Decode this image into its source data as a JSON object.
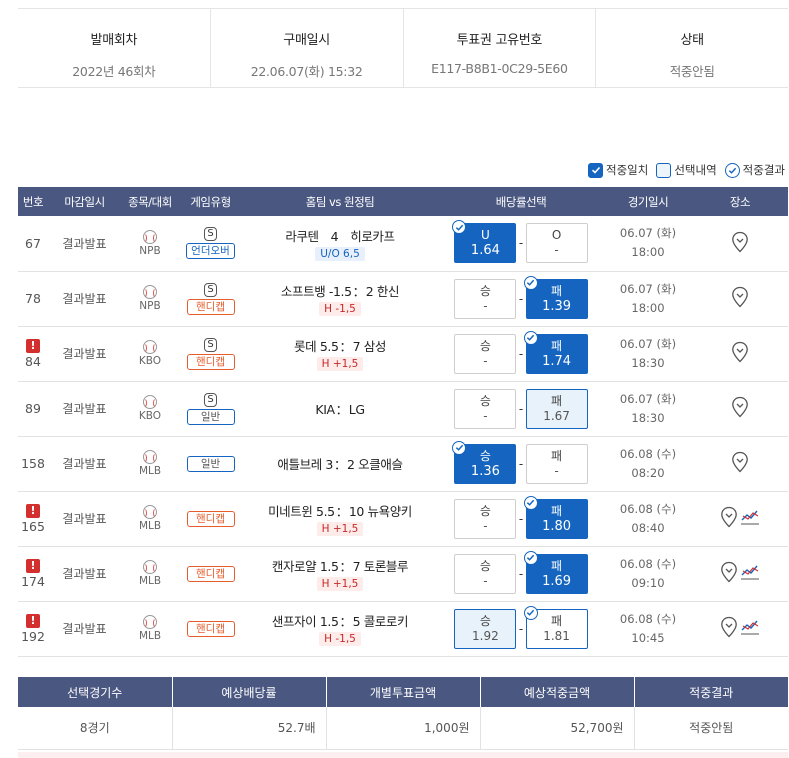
{
  "info": [
    {
      "label": "발매회차",
      "value": "2022년 46회차"
    },
    {
      "label": "구매일시",
      "value": "22.06.07(화) 15:32"
    },
    {
      "label": "투표권 고유번호",
      "value": "E117-B8B1-0C29-5E60"
    },
    {
      "label": "상태",
      "value": "적중안됨"
    }
  ],
  "legend": [
    {
      "label": "적중일치",
      "style": "checked"
    },
    {
      "label": "선택내역",
      "style": "empty"
    },
    {
      "label": "적중결과",
      "style": "circle-check"
    }
  ],
  "headers": [
    "번호",
    "마감일시",
    "종목/대회",
    "게임유형",
    "홈팀 vs 원정팀",
    "배당률선택",
    "경기일시",
    "장소"
  ],
  "rows": [
    {
      "no": "67",
      "warn": false,
      "deadline": "결과발표",
      "league": "NPB",
      "s_badge": "S",
      "type": "언더오버",
      "type_style": "blue",
      "home": "라쿠텐",
      "score": "4",
      "away": "히로카프",
      "sep": "",
      "handicap": "U/O 6,5",
      "handicap_style": "blue",
      "win_label": "U",
      "win_odds": "1.64",
      "win_state": "sel",
      "win_check": true,
      "draw": "-",
      "lose_label": "O",
      "lose_odds": "-",
      "lose_state": "plain",
      "lose_check": false,
      "date": "06.07 (화)",
      "time": "18:00",
      "extra_chart": false
    },
    {
      "no": "78",
      "warn": false,
      "deadline": "결과발표",
      "league": "NPB",
      "s_badge": "S",
      "type": "핸디캡",
      "type_style": "red",
      "home": "소프트뱅 -1.5",
      "score": "",
      "away": "2 한신",
      "sep": "：",
      "handicap": "H -1,5",
      "handicap_style": "red",
      "win_label": "승",
      "win_odds": "-",
      "win_state": "plain",
      "win_check": false,
      "draw": "-",
      "lose_label": "패",
      "lose_odds": "1.39",
      "lose_state": "sel",
      "lose_check": true,
      "date": "06.07 (화)",
      "time": "18:00",
      "extra_chart": false
    },
    {
      "no": "84",
      "warn": true,
      "deadline": "결과발표",
      "league": "KBO",
      "s_badge": "S",
      "type": "핸디캡",
      "type_style": "red",
      "home": "롯데 5.5",
      "score": "",
      "away": "7 삼성",
      "sep": "：",
      "handicap": "H +1,5",
      "handicap_style": "red",
      "win_label": "승",
      "win_odds": "-",
      "win_state": "plain",
      "win_check": false,
      "draw": "-",
      "lose_label": "패",
      "lose_odds": "1.74",
      "lose_state": "sel",
      "lose_check": true,
      "date": "06.07 (화)",
      "time": "18:30",
      "extra_chart": false
    },
    {
      "no": "89",
      "warn": false,
      "deadline": "결과발표",
      "league": "KBO",
      "s_badge": "S",
      "type": "일반",
      "type_style": "gray",
      "home": "KIA",
      "score": "",
      "away": "LG",
      "sep": "：",
      "handicap": "",
      "handicap_style": "",
      "win_label": "승",
      "win_odds": "-",
      "win_state": "plain",
      "win_check": false,
      "draw": "-",
      "lose_label": "패",
      "lose_odds": "1.67",
      "lose_state": "light",
      "lose_check": false,
      "date": "06.07 (화)",
      "time": "18:30",
      "extra_chart": false
    },
    {
      "no": "158",
      "warn": false,
      "deadline": "결과발표",
      "league": "MLB",
      "s_badge": "",
      "type": "일반",
      "type_style": "gray",
      "home": "애틀브레 3",
      "score": "",
      "away": "2 오클애슬",
      "sep": "：",
      "handicap": "",
      "handicap_style": "",
      "win_label": "승",
      "win_odds": "1.36",
      "win_state": "sel",
      "win_check": true,
      "draw": "-",
      "lose_label": "패",
      "lose_odds": "-",
      "lose_state": "plain",
      "lose_check": false,
      "date": "06.08 (수)",
      "time": "08:20",
      "extra_chart": false
    },
    {
      "no": "165",
      "warn": true,
      "deadline": "결과발표",
      "league": "MLB",
      "s_badge": "",
      "type": "핸디캡",
      "type_style": "red",
      "home": "미네트윈 5.5",
      "score": "",
      "away": "10 뉴욕양키",
      "sep": "：",
      "handicap": "H +1,5",
      "handicap_style": "red",
      "win_label": "승",
      "win_odds": "-",
      "win_state": "plain",
      "win_check": false,
      "draw": "-",
      "lose_label": "패",
      "lose_odds": "1.80",
      "lose_state": "sel",
      "lose_check": true,
      "date": "06.08 (수)",
      "time": "08:40",
      "extra_chart": true
    },
    {
      "no": "174",
      "warn": true,
      "deadline": "결과발표",
      "league": "MLB",
      "s_badge": "",
      "type": "핸디캡",
      "type_style": "red",
      "home": "캔자로얄 1.5",
      "score": "",
      "away": "7 토론블루",
      "sep": "：",
      "handicap": "H +1,5",
      "handicap_style": "red",
      "win_label": "승",
      "win_odds": "-",
      "win_state": "plain",
      "win_check": false,
      "draw": "-",
      "lose_label": "패",
      "lose_odds": "1.69",
      "lose_state": "sel",
      "lose_check": true,
      "date": "06.08 (수)",
      "time": "09:10",
      "extra_chart": true
    },
    {
      "no": "192",
      "warn": true,
      "deadline": "결과발표",
      "league": "MLB",
      "s_badge": "",
      "type": "핸디캡",
      "type_style": "red",
      "home": "샌프자이 1.5",
      "score": "",
      "away": "5 콜로로키",
      "sep": "：",
      "handicap": "H -1,5",
      "handicap_style": "red",
      "win_label": "승",
      "win_odds": "1.92",
      "win_state": "light",
      "win_check": false,
      "draw": "-",
      "lose_label": "패",
      "lose_odds": "1.81",
      "lose_state": "outline",
      "lose_check": true,
      "date": "06.08 (수)",
      "time": "10:45",
      "extra_chart": true
    }
  ],
  "summary": {
    "headers": [
      "선택경기수",
      "예상배당률",
      "개별투표금액",
      "예상적중금액",
      "적중결과"
    ],
    "values": [
      "8경기",
      "52.7배",
      "1,000원",
      "52,700원",
      "적중안됨"
    ]
  },
  "colors": {
    "header_bg": "#4a5780",
    "accent": "#1565c0",
    "warn": "#d32f2f",
    "handicap_red": "#e65c2b"
  }
}
